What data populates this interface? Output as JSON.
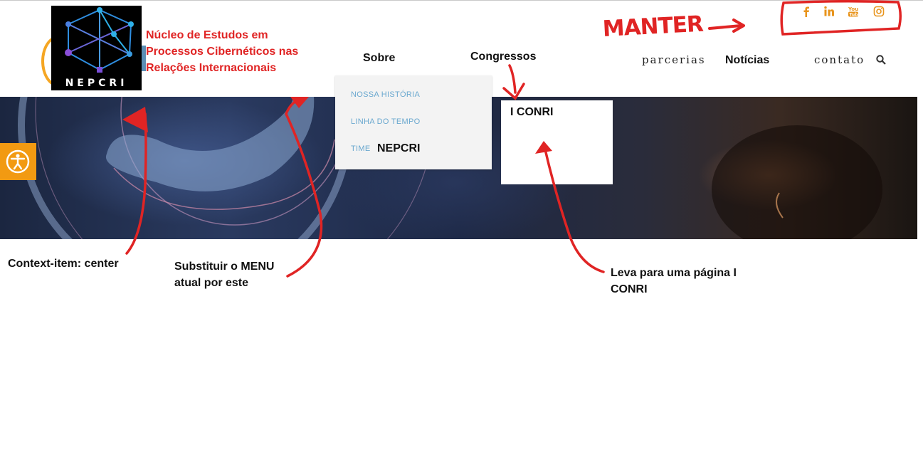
{
  "header": {
    "logo_text": "NEPCRI",
    "org_name_lines": [
      "Núcleo de Estudos em",
      "Processos Cibernéticos nas",
      "Relações Internacionais"
    ]
  },
  "nav": {
    "sobre": "Sobre",
    "congressos": "Congressos",
    "parcerias": "parcerias",
    "noticias": "Notícias",
    "contato": "contato"
  },
  "social_icons": [
    "facebook-icon",
    "linkedin-icon",
    "youtube-icon",
    "instagram-icon"
  ],
  "dropdown_sobre": {
    "items": [
      "NOSSA HISTÓRIA",
      "LINHA DO TEMPO",
      "TIME"
    ],
    "overlay_text": "NEPCRI"
  },
  "dropdown_congressos": {
    "items": [
      "I CONRI"
    ]
  },
  "annotations": {
    "manter": "MANTER",
    "context_item": "Context-item: center",
    "substituir_lines": [
      "Substituir o MENU",
      "atual por este"
    ],
    "leva_lines": [
      "Leva para uma página I",
      "CONRI"
    ]
  },
  "colors": {
    "accent_orange": "#f29a12",
    "annotation_red": "#e02424",
    "dropdown_link": "#6aa8cf",
    "dropdown_bg": "#f3f3f3"
  }
}
